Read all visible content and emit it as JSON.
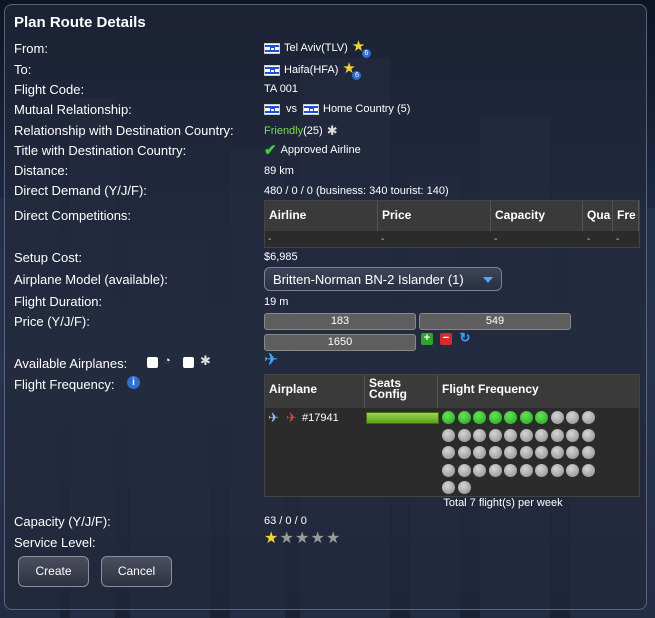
{
  "dialog": {
    "title": "Plan Route Details"
  },
  "labels": {
    "from": "From:",
    "to": "To:",
    "flight_code": "Flight Code:",
    "mutual_relationship": "Mutual Relationship:",
    "relationship_destination": "Relationship with Destination Country:",
    "title_destination": "Title with Destination Country:",
    "distance": "Distance:",
    "direct_demand": "Direct Demand (Y/J/F):",
    "direct_competitions": "Direct Competitions:",
    "setup_cost": "Setup Cost:",
    "airplane_model": "Airplane Model (available):",
    "flight_duration": "Flight Duration:",
    "price": "Price (Y/J/F):",
    "available_airplanes": "Available Airplanes:",
    "flight_frequency": "Flight Frequency:",
    "capacity": "Capacity (Y/J/F):",
    "service_level": "Service Level:"
  },
  "values": {
    "from": "Tel Aviv(TLV)",
    "from_badge": "6",
    "to": "Haifa(HFA)",
    "to_badge": "6",
    "flight_code": "TA 001",
    "mutual_vs": "vs",
    "mutual_country": "Home Country (5)",
    "relationship_status": "Friendly",
    "relationship_value": "(25)",
    "title_status": "Approved Airline",
    "distance": "89 km",
    "direct_demand": "480 / 0 / 0 (business: 340 tourist: 140)",
    "setup_cost": "$6,985",
    "airplane_model": "Britten-Norman BN-2 Islander (1)",
    "flight_duration": "19 m",
    "price_y": "183",
    "price_j": "549",
    "price_f": "1650",
    "capacity": "63 / 0 / 0",
    "service_level_stars": 1,
    "service_level_max": 5
  },
  "competitions": {
    "headers": [
      "Airline",
      "Price",
      "Capacity",
      "Qua",
      "Fre"
    ],
    "row": [
      "-",
      "-",
      "-",
      "-",
      "-"
    ]
  },
  "frequency": {
    "headers": [
      "Airplane",
      "Seats Config",
      "Flight Frequency"
    ],
    "airplane_id": "#17941",
    "selected": 7,
    "total_slots": 42,
    "total_text": "Total 7 flight(s) per week"
  },
  "buttons": {
    "create": "Create",
    "cancel": "Cancel"
  },
  "colors": {
    "friendly": "#7ed957",
    "dot_on": "#1fbf22",
    "accent_blue": "#4aa8ff"
  }
}
